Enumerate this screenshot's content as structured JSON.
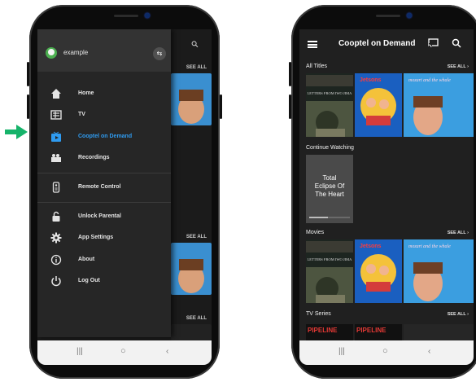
{
  "left_phone": {
    "drawer": {
      "username": "example",
      "items": [
        {
          "label": "Home",
          "icon": "home-icon"
        },
        {
          "label": "TV",
          "icon": "tv-guide-icon"
        },
        {
          "label": "Cooptel on Demand",
          "icon": "on-demand-icon",
          "active": true
        },
        {
          "label": "Recordings",
          "icon": "recordings-icon"
        },
        {
          "label": "Remote Control",
          "icon": "remote-icon"
        },
        {
          "label": "Unlock Parental",
          "icon": "unlock-icon"
        },
        {
          "label": "App Settings",
          "icon": "gear-icon"
        },
        {
          "label": "About",
          "icon": "info-icon"
        },
        {
          "label": "Log Out",
          "icon": "power-icon"
        }
      ]
    },
    "behind": {
      "see_all_1": "SEE ALL",
      "see_all_2": "SEE ALL",
      "see_all_3": "SEE ALL"
    }
  },
  "right_phone": {
    "app_title": "Cooptel on Demand",
    "sections": {
      "all_titles": {
        "title": "All Titles",
        "see_all": "SEE ALL"
      },
      "continue_watching": {
        "title": "Continue Watching",
        "card_title": "Total Eclipse Of The Heart",
        "progress": 0.45
      },
      "movies": {
        "title": "Movies",
        "see_all": "SEE ALL"
      },
      "tv_series": {
        "title": "TV Series",
        "see_all": "SEE ALL"
      }
    },
    "posters": {
      "p1_title": "LETTERS FROM IWO JIMA",
      "p2_title": "Jetsons",
      "p3_title": "mozart and the whale",
      "tv1": "PIPELINE",
      "tv2": "PIPELINE"
    }
  },
  "colors": {
    "accent": "#2f9bf0",
    "arrow": "#16b36a",
    "drawer_bg": "#262626",
    "screen_bg": "#202020"
  }
}
